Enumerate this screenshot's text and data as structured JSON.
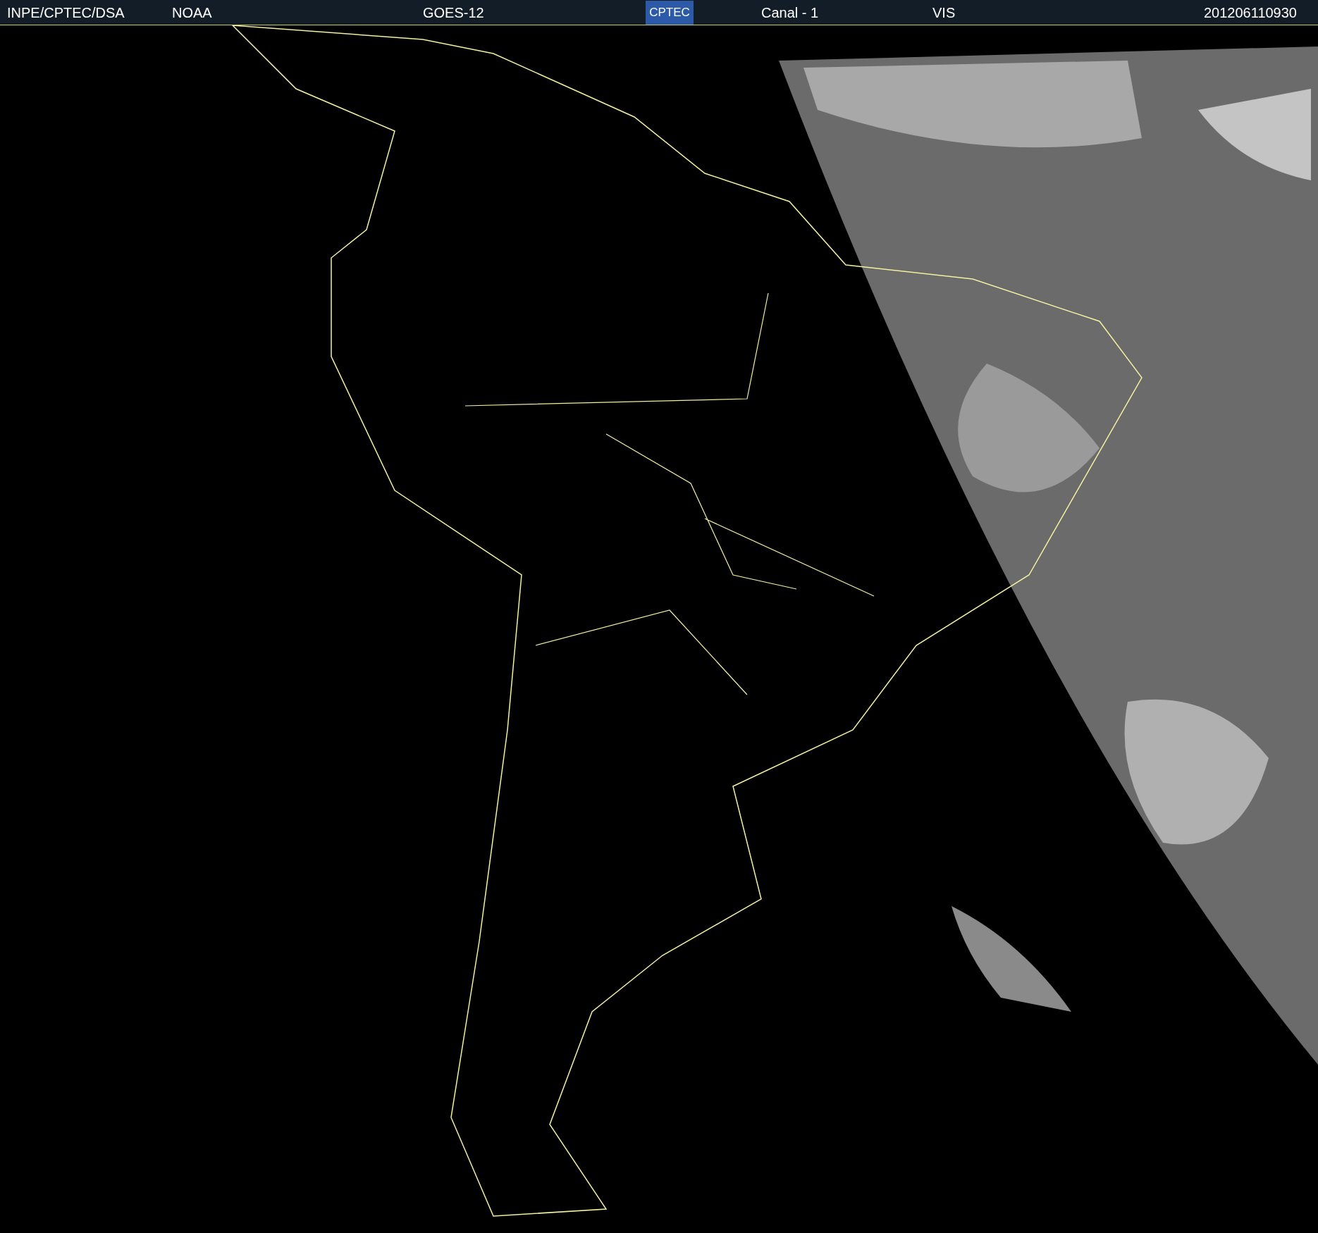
{
  "header": {
    "source": "INPE/CPTEC/DSA",
    "agency": "NOAA",
    "satellite": "GOES-12",
    "logo": "CPTEC",
    "channel": "Canal - 1",
    "band": "VIS",
    "timestamp": "201206110930"
  }
}
